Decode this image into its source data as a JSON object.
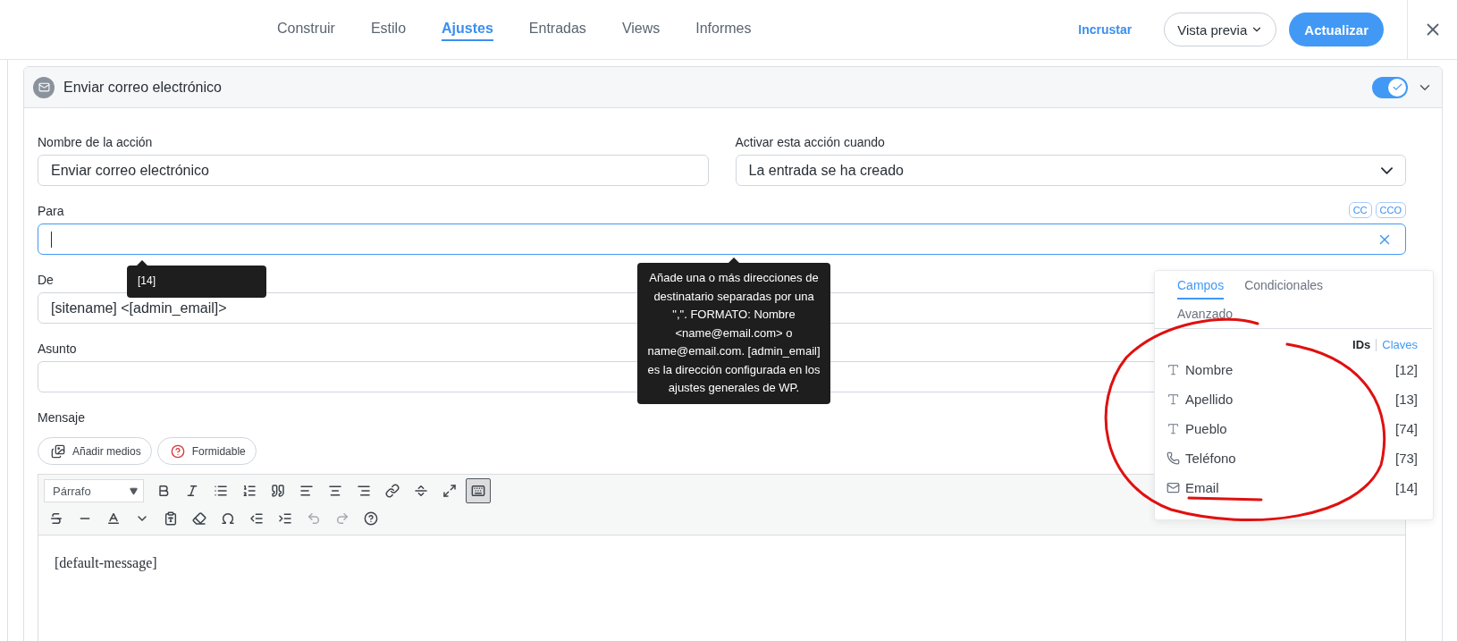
{
  "nav": {
    "tabs": [
      {
        "label": "Construir",
        "selected": false
      },
      {
        "label": "Estilo",
        "selected": false
      },
      {
        "label": "Ajustes",
        "selected": true
      },
      {
        "label": "Entradas",
        "selected": false
      },
      {
        "label": "Views",
        "selected": false
      },
      {
        "label": "Informes",
        "selected": false
      }
    ],
    "embed": "Incrustar",
    "preview": "Vista previa",
    "update": "Actualizar"
  },
  "action": {
    "title": "Enviar correo electrónico",
    "enabled": true,
    "name_label": "Nombre de la acción",
    "name_value": "Enviar correo electrónico",
    "trigger_label": "Activar esta acción cuando",
    "trigger_value": "La entrada se ha creado",
    "to_label": "Para",
    "cc": "CC",
    "bcc": "CCO",
    "from_label": "De",
    "from_value": "[sitename] <[admin_email]>",
    "subject_label": "Asunto",
    "message_label": "Mensaje",
    "media_button": "Añadir medios",
    "formidable_button": "Formidable",
    "format": "Párrafo",
    "kitchen_sink_on": true,
    "message_value": "[default-message]"
  },
  "tag_tooltip": "[14]",
  "help_tooltip": "Añade una o más direcciones de destinatario separadas por una \",\". FORMATO: Nombre <name@email.com> o name@email.com. [admin_email] es la dirección configurada en los ajustes generales de WP.",
  "field_panel": {
    "tabs": [
      {
        "label": "Campos",
        "selected": true
      },
      {
        "label": "Condicionales",
        "selected": false
      },
      {
        "label": "Avanzado",
        "selected": false
      }
    ],
    "modes": [
      {
        "label": "IDs",
        "selected": true
      },
      {
        "label": "Claves",
        "selected": false
      }
    ],
    "fields": [
      {
        "kind": "text",
        "name": "Nombre",
        "id": "[12]"
      },
      {
        "kind": "text",
        "name": "Apellido",
        "id": "[13]"
      },
      {
        "kind": "text",
        "name": "Pueblo",
        "id": "[74]"
      },
      {
        "kind": "phone",
        "name": "Teléfono",
        "id": "[73]"
      },
      {
        "kind": "email",
        "name": "Email",
        "id": "[14]"
      }
    ]
  }
}
